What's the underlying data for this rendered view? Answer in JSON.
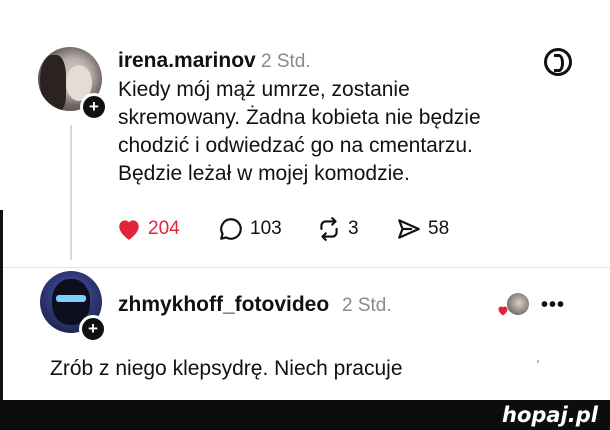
{
  "post": {
    "username": "irena.marinov",
    "time": "2 Std.",
    "body_lines": [
      "Kiedy mój mąż umrze, zostanie",
      "skremowany. Żadna kobieta nie będzie",
      "chodzić i odwiedzać go na cmentarzu.",
      "Będzie leżał w mojej komodzie."
    ],
    "likes": "204",
    "comments": "103",
    "reposts": "3",
    "shares": "58",
    "colors": {
      "like": "#e0243a",
      "text": "#111111",
      "muted": "#8a8a8a"
    }
  },
  "reply": {
    "username": "zhmykhoff_fotovideo",
    "time": "2 Std.",
    "body": "Zrób z niego klepsydrę. Niech pracuje",
    "more": "•••"
  },
  "icons": [
    "threads-logo-icon",
    "heart-icon",
    "comment-icon",
    "repost-icon",
    "share-icon",
    "plus-icon",
    "more-icon"
  ],
  "watermark": "hopaj.pl"
}
